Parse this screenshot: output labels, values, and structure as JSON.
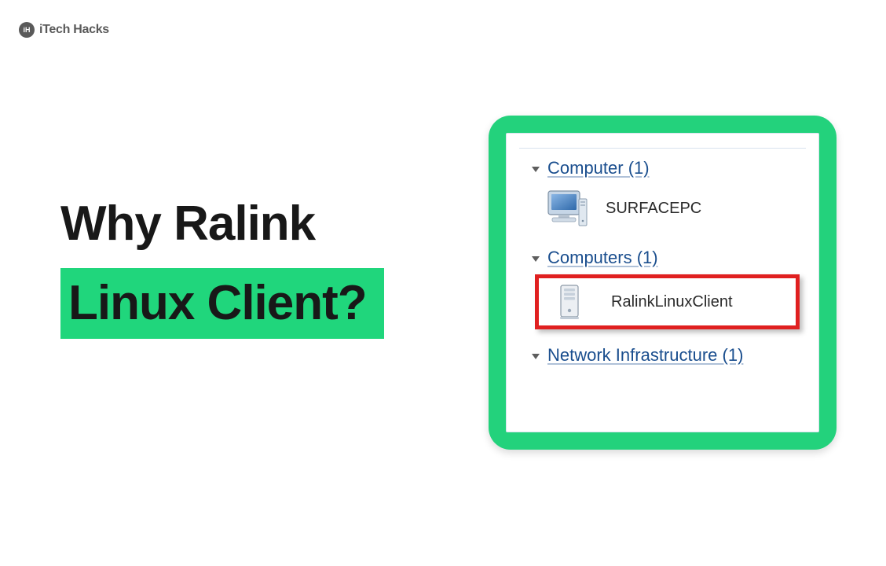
{
  "logo": {
    "badge": "iH",
    "text": "iTech Hacks"
  },
  "headline": {
    "line1": "Why Ralink",
    "line2": "Linux Client?"
  },
  "network_panel": {
    "groups": [
      {
        "label": "Computer (1)",
        "items": [
          {
            "name": "SURFACEPC",
            "icon": "desktop-pc"
          }
        ]
      },
      {
        "label": "Computers (1)",
        "items": [
          {
            "name": "RalinkLinuxClient",
            "icon": "tower",
            "highlighted": true
          }
        ]
      },
      {
        "label": "Network Infrastructure (1)",
        "items": []
      }
    ]
  }
}
